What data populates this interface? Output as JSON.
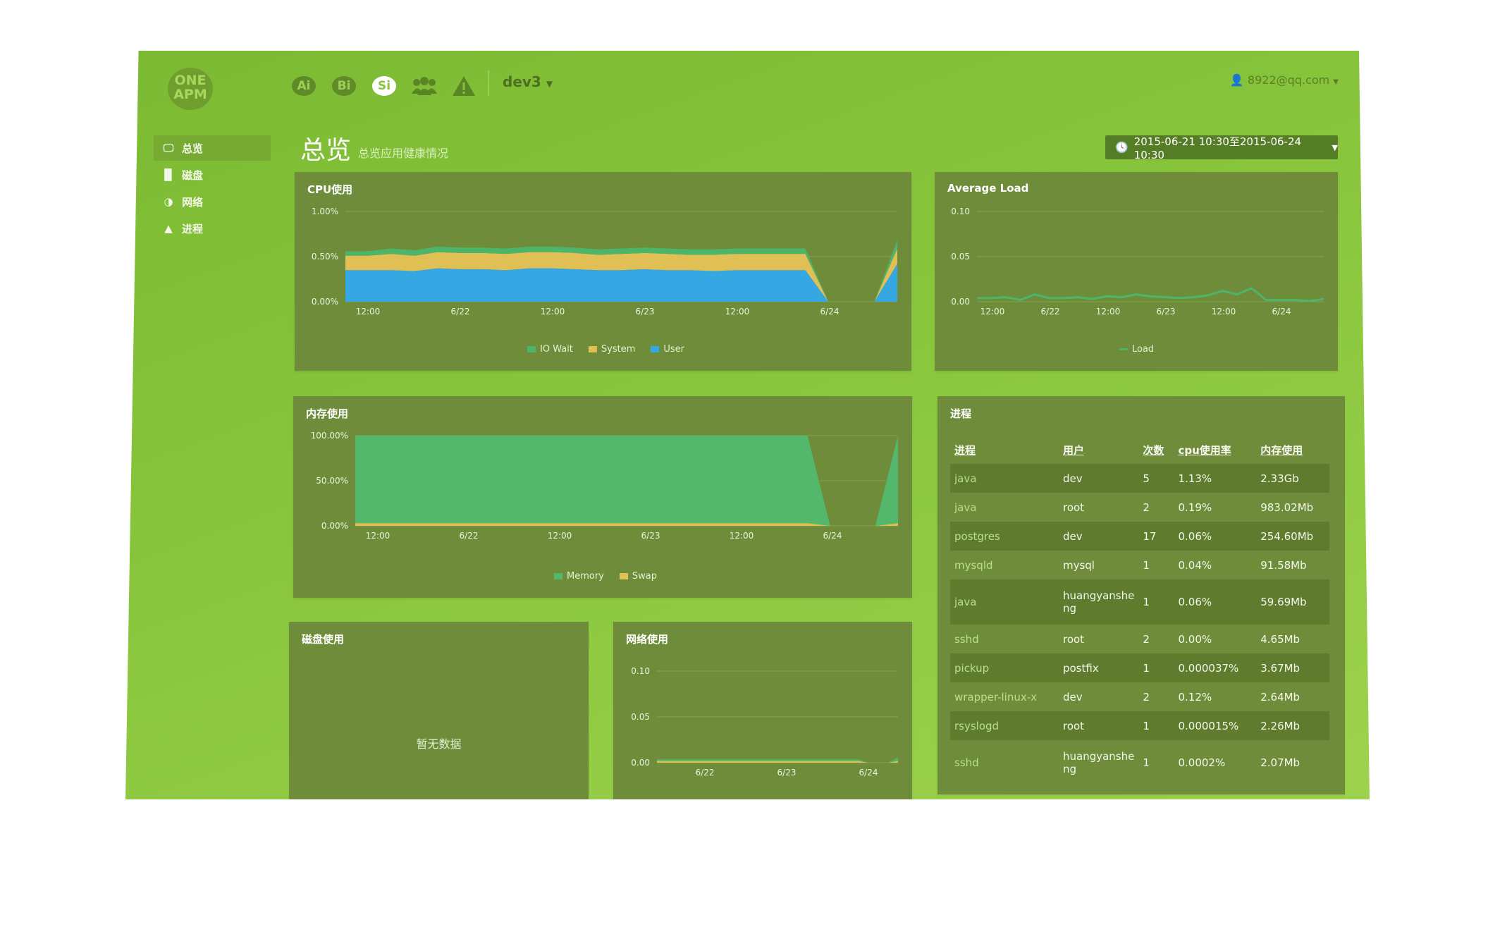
{
  "header": {
    "logo_text": "ONE APM",
    "product_badges": [
      {
        "label": "Ai",
        "active": false
      },
      {
        "label": "Bi",
        "active": false
      },
      {
        "label": "Si",
        "active": true
      }
    ],
    "users_icon": "users-icon",
    "alert_icon": "warning-icon",
    "env_selector": "dev3",
    "user_email": "8922@qq.com"
  },
  "sidebar": {
    "items": [
      {
        "label": "总览",
        "icon": "monitor-icon",
        "active": true
      },
      {
        "label": "磁盘",
        "icon": "file-icon",
        "active": false
      },
      {
        "label": "网络",
        "icon": "half-circle-icon",
        "active": false
      },
      {
        "label": "进程",
        "icon": "warning-icon",
        "active": false
      }
    ]
  },
  "page": {
    "title": "总览",
    "subtitle": "总览应用健康情况",
    "date_range": "2015-06-21 10:30至2015-06-24 10:30"
  },
  "colors": {
    "io_wait": "#4cb56a",
    "system": "#e0bf55",
    "user": "#35a7e3",
    "memory": "#53b86b",
    "swap": "#e0bf55",
    "load": "#4cb56a"
  },
  "panels": {
    "cpu": {
      "title": "CPU使用"
    },
    "load": {
      "title": "Average Load"
    },
    "memory": {
      "title": "内存使用"
    },
    "disk": {
      "title": "磁盘使用",
      "empty_text": "暂无数据"
    },
    "network": {
      "title": "网络使用"
    },
    "process": {
      "title": "进程"
    }
  },
  "chart_data": [
    {
      "type": "area",
      "title": "CPU使用",
      "y_ticks": [
        "1.00%",
        "0.50%",
        "0.00%"
      ],
      "ylim": [
        0,
        1.0
      ],
      "x_ticks": [
        "12:00",
        "6/22",
        "12:00",
        "6/23",
        "12:00",
        "6/24"
      ],
      "x": [
        0,
        1,
        2,
        3,
        4,
        5,
        6,
        7,
        8,
        9,
        10,
        11,
        12,
        13,
        14,
        15,
        16,
        17,
        18,
        19,
        20,
        21,
        22,
        23,
        24
      ],
      "series": [
        {
          "name": "User",
          "values": [
            0.35,
            0.35,
            0.35,
            0.34,
            0.37,
            0.36,
            0.36,
            0.35,
            0.37,
            0.37,
            0.36,
            0.35,
            0.35,
            0.36,
            0.35,
            0.35,
            0.34,
            0.35,
            0.35,
            0.35,
            0.35,
            0.0,
            0.0,
            0.0,
            0.42
          ]
        },
        {
          "name": "System",
          "values": [
            0.16,
            0.16,
            0.18,
            0.17,
            0.18,
            0.18,
            0.18,
            0.18,
            0.18,
            0.18,
            0.18,
            0.17,
            0.18,
            0.18,
            0.18,
            0.17,
            0.18,
            0.18,
            0.18,
            0.18,
            0.18,
            0.0,
            0.0,
            0.0,
            0.17
          ]
        },
        {
          "name": "IO Wait",
          "values": [
            0.05,
            0.05,
            0.06,
            0.06,
            0.06,
            0.06,
            0.06,
            0.06,
            0.06,
            0.06,
            0.06,
            0.06,
            0.06,
            0.06,
            0.06,
            0.06,
            0.06,
            0.06,
            0.06,
            0.06,
            0.06,
            0.0,
            0.0,
            0.0,
            0.09
          ]
        }
      ]
    },
    {
      "type": "line",
      "title": "Average Load",
      "y_ticks": [
        "0.10",
        "0.05",
        "0.00"
      ],
      "ylim": [
        0,
        0.1
      ],
      "x_ticks": [
        "12:00",
        "6/22",
        "12:00",
        "6/23",
        "12:00",
        "6/24"
      ],
      "x": [
        0,
        1,
        2,
        3,
        4,
        5,
        6,
        7,
        8,
        9,
        10,
        11,
        12,
        13,
        14,
        15,
        16,
        17,
        18,
        19,
        20,
        21,
        22,
        23,
        24
      ],
      "series": [
        {
          "name": "Load",
          "values": [
            0.004,
            0.004,
            0.005,
            0.002,
            0.008,
            0.004,
            0.004,
            0.005,
            0.003,
            0.006,
            0.005,
            0.008,
            0.006,
            0.005,
            0.004,
            0.005,
            0.007,
            0.012,
            0.008,
            0.015,
            0.002,
            0.002,
            0.002,
            0.001,
            0.003
          ]
        }
      ]
    },
    {
      "type": "area",
      "title": "内存使用",
      "y_ticks": [
        "100.00%",
        "50.00%",
        "0.00%"
      ],
      "ylim": [
        0,
        100
      ],
      "x_ticks": [
        "12:00",
        "6/22",
        "12:00",
        "6/23",
        "12:00",
        "6/24"
      ],
      "x": [
        0,
        1,
        2,
        3,
        4,
        5,
        6,
        7,
        8,
        9,
        10,
        11,
        12,
        13,
        14,
        15,
        16,
        17,
        18,
        19,
        20,
        21,
        22,
        23,
        24
      ],
      "series": [
        {
          "name": "Swap",
          "values": [
            3,
            3,
            3,
            3,
            3,
            3,
            3,
            3,
            3,
            3,
            3,
            3,
            3,
            3,
            3,
            3,
            3,
            3,
            3,
            3,
            3,
            0,
            0,
            0,
            3
          ]
        },
        {
          "name": "Memory",
          "values": [
            97,
            97,
            97,
            97,
            97,
            97,
            97,
            97,
            97,
            97,
            97,
            97,
            97,
            97,
            97,
            97,
            97,
            97,
            97,
            97,
            97,
            0,
            0,
            0,
            97
          ]
        }
      ]
    },
    {
      "type": "area",
      "title": "网络使用",
      "y_ticks": [
        "0.10",
        "0.05",
        "0.00"
      ],
      "ylim": [
        0,
        0.1
      ],
      "x_ticks": [
        "6/22",
        "6/23",
        "6/24"
      ],
      "x": [
        0,
        1,
        2,
        3,
        4,
        5,
        6,
        7,
        8,
        9,
        10,
        11,
        12,
        13,
        14,
        15,
        16,
        17,
        18,
        19,
        20,
        21,
        22,
        23,
        24
      ],
      "series": [
        {
          "name": "",
          "values": [
            0.002,
            0.002,
            0.002,
            0.002,
            0.002,
            0.002,
            0.002,
            0.002,
            0.002,
            0.002,
            0.002,
            0.002,
            0.002,
            0.002,
            0.002,
            0.002,
            0.002,
            0.002,
            0.002,
            0.002,
            0.002,
            0.0,
            0.0,
            0.0,
            0.002
          ]
        },
        {
          "name": "",
          "values": [
            0.002,
            0.002,
            0.002,
            0.002,
            0.002,
            0.002,
            0.002,
            0.002,
            0.002,
            0.002,
            0.002,
            0.002,
            0.002,
            0.002,
            0.002,
            0.002,
            0.002,
            0.002,
            0.002,
            0.002,
            0.002,
            0.0,
            0.0,
            0.0,
            0.004
          ]
        }
      ]
    }
  ],
  "process_table": {
    "columns": [
      "进程",
      "用户",
      "次数",
      "cpu使用率",
      "内存使用"
    ],
    "rows": [
      {
        "name": "java",
        "user": "dev",
        "count": "5",
        "cpu": "1.13%",
        "mem": "2.33Gb"
      },
      {
        "name": "java",
        "user": "root",
        "count": "2",
        "cpu": "0.19%",
        "mem": "983.02Mb"
      },
      {
        "name": "postgres",
        "user": "dev",
        "count": "17",
        "cpu": "0.06%",
        "mem": "254.60Mb"
      },
      {
        "name": "mysqld",
        "user": "mysql",
        "count": "1",
        "cpu": "0.04%",
        "mem": "91.58Mb"
      },
      {
        "name": "java",
        "user": "huangyanshe ng",
        "count": "1",
        "cpu": "0.06%",
        "mem": "59.69Mb"
      },
      {
        "name": "sshd",
        "user": "root",
        "count": "2",
        "cpu": "0.00%",
        "mem": "4.65Mb"
      },
      {
        "name": "pickup",
        "user": "postfix",
        "count": "1",
        "cpu": "0.000037%",
        "mem": "3.67Mb"
      },
      {
        "name": "wrapper-linux-x",
        "user": "dev",
        "count": "2",
        "cpu": "0.12%",
        "mem": "2.64Mb"
      },
      {
        "name": "rsyslogd",
        "user": "root",
        "count": "1",
        "cpu": "0.000015%",
        "mem": "2.26Mb"
      },
      {
        "name": "sshd",
        "user": "huangyanshe ng",
        "count": "1",
        "cpu": "0.0002%",
        "mem": "2.07Mb"
      }
    ]
  }
}
